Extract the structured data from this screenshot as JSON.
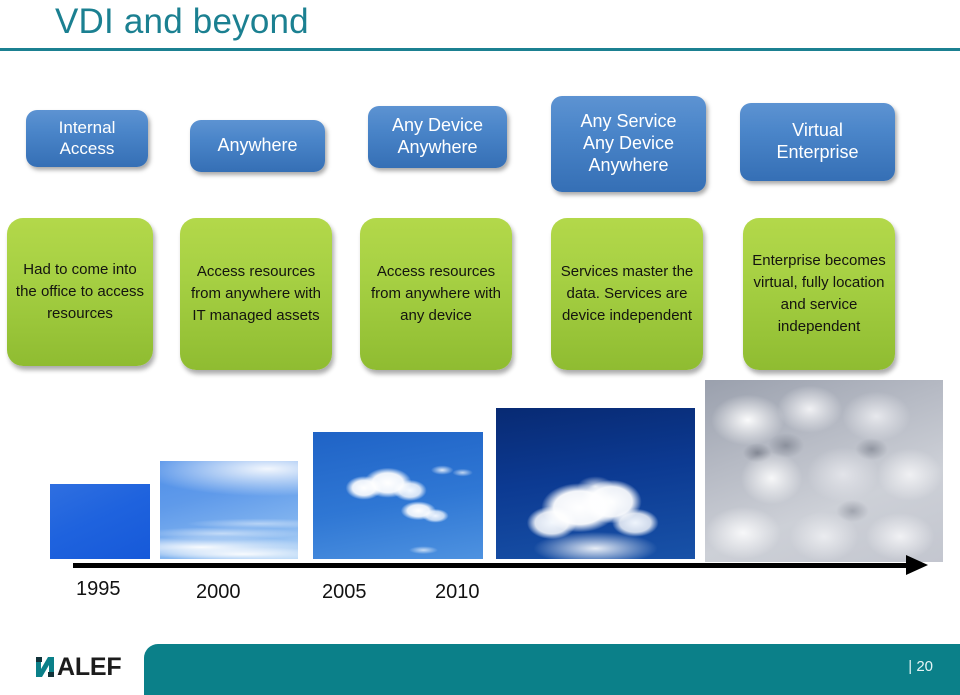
{
  "slide": {
    "title": "VDI and beyond",
    "page_number": "| 20",
    "accent_teal": "#1b8091",
    "footer_teal": "#0b8089",
    "blue_box_color": "#4a85c9",
    "green_box_color": "#a6d043"
  },
  "logo": {
    "mark": "alef-n-mark-icon",
    "text": "ALEF"
  },
  "stages": [
    {
      "blue_lines": [
        "Internal",
        "Access"
      ],
      "green_text": "Had to come into the office to access resources"
    },
    {
      "blue_lines": [
        "Anywhere"
      ],
      "green_text": "Access resources from anywhere with IT managed assets"
    },
    {
      "blue_lines": [
        "Any Device",
        "Anywhere"
      ],
      "green_text": "Access resources from anywhere with any device"
    },
    {
      "blue_lines": [
        "Any Service",
        "Any Device",
        "Anywhere"
      ],
      "green_text": "Services master the data. Services are device independent"
    },
    {
      "blue_lines": [
        "Virtual",
        "Enterprise"
      ],
      "green_text": "Enterprise becomes virtual, fully location and service independent"
    }
  ],
  "timeline": {
    "years": [
      "1995",
      "2000",
      "2005",
      "2010"
    ],
    "images": [
      "solid-blue-sky-image",
      "wispy-cirrus-sky-image",
      "blue-sky-small-clouds-image",
      "large-cumulus-cloud-image",
      "dense-cloud-mass-image"
    ]
  }
}
